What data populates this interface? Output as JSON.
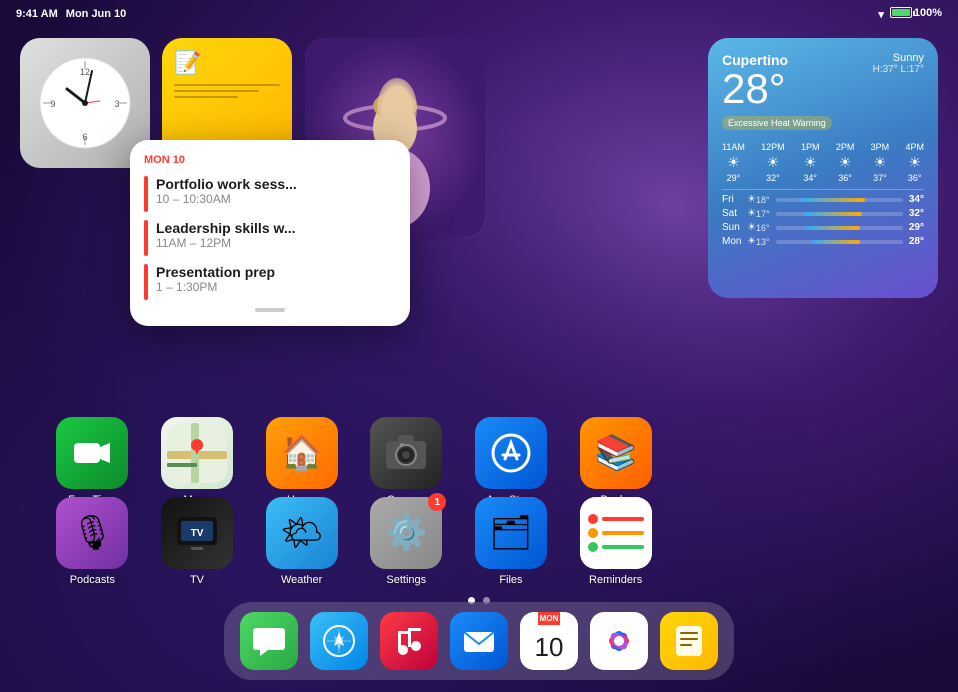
{
  "statusBar": {
    "time": "9:41 AM",
    "date": "Mon Jun 10",
    "wifi": "▼▲",
    "battery": "100%"
  },
  "weatherWidget": {
    "city": "Cupertino",
    "temperature": "28°",
    "condition": "Sunny",
    "high": "H:37°",
    "low": "L:17°",
    "warning": "Excessive Heat Warning",
    "hourly": [
      {
        "time": "11AM",
        "icon": "☀",
        "temp": "29°"
      },
      {
        "time": "12PM",
        "icon": "☀",
        "temp": "32°"
      },
      {
        "time": "1PM",
        "icon": "☀",
        "temp": "34°"
      },
      {
        "time": "2PM",
        "icon": "☀",
        "temp": "36°"
      },
      {
        "time": "3PM",
        "icon": "☀",
        "temp": "37°"
      },
      {
        "time": "4PM",
        "icon": "☀",
        "temp": "36°"
      }
    ],
    "daily": [
      {
        "day": "Fri",
        "icon": "☀",
        "low": "18°",
        "high": "34°",
        "barLeft": "20%",
        "barWidth": "50%"
      },
      {
        "day": "Sat",
        "icon": "☀",
        "low": "17°",
        "high": "32°",
        "barLeft": "22%",
        "barWidth": "48%"
      },
      {
        "day": "Sun",
        "icon": "☀",
        "low": "16°",
        "high": "29°",
        "barLeft": "24%",
        "barWidth": "45%"
      },
      {
        "day": "Mon",
        "icon": "☀",
        "low": "13°",
        "high": "28°",
        "barLeft": "28%",
        "barWidth": "40%"
      }
    ]
  },
  "calendarPopup": {
    "dayLabel": "MON",
    "dayNumber": "10",
    "events": [
      {
        "title": "Portfolio work sess...",
        "time": "10 – 10:30AM"
      },
      {
        "title": "Leadership skills w...",
        "time": "11AM – 12PM"
      },
      {
        "title": "Presentation prep",
        "time": "1 – 1:30PM"
      }
    ]
  },
  "appsRow1": [
    {
      "id": "facetime",
      "label": "FaceTime",
      "icon": "📹",
      "iconClass": "icon-facetime"
    },
    {
      "id": "maps",
      "label": "Maps",
      "icon": "🗺",
      "iconClass": "icon-maps"
    },
    {
      "id": "home",
      "label": "Home",
      "icon": "🏠",
      "iconClass": "icon-home"
    },
    {
      "id": "camera",
      "label": "Camera",
      "icon": "📷",
      "iconClass": "icon-camera"
    },
    {
      "id": "appstore",
      "label": "App Store",
      "icon": "Ⓐ",
      "iconClass": "icon-appstore"
    },
    {
      "id": "books",
      "label": "Books",
      "icon": "📚",
      "iconClass": "icon-books"
    }
  ],
  "appsRow2": [
    {
      "id": "podcasts",
      "label": "Podcasts",
      "icon": "🎙",
      "iconClass": "icon-podcasts"
    },
    {
      "id": "tv",
      "label": "TV",
      "icon": "📺",
      "iconClass": "icon-tv"
    },
    {
      "id": "weather",
      "label": "Weather",
      "icon": "🌤",
      "iconClass": "icon-weather"
    },
    {
      "id": "settings",
      "label": "Settings",
      "icon": "⚙️",
      "iconClass": "icon-settings",
      "badge": "1"
    },
    {
      "id": "files",
      "label": "Files",
      "icon": "🗂",
      "iconClass": "icon-files"
    },
    {
      "id": "reminders",
      "label": "Reminders",
      "icon": "📋",
      "iconClass": "icon-reminders"
    }
  ],
  "dock": {
    "items": [
      {
        "id": "messages",
        "iconClass": "icon-messages",
        "icon": "💬"
      },
      {
        "id": "safari",
        "iconClass": "icon-safari",
        "icon": "🧭"
      },
      {
        "id": "music",
        "iconClass": "icon-music",
        "icon": "🎵"
      },
      {
        "id": "mail",
        "iconClass": "icon-mail",
        "icon": "✉️"
      },
      {
        "id": "calendar",
        "iconClass": "icon-calendar-dock",
        "dayLabel": "MON",
        "day": "10"
      },
      {
        "id": "photos",
        "iconClass": "icon-photos",
        "icon": "🌸"
      },
      {
        "id": "notes",
        "iconClass": "icon-notes-dock",
        "icon": "📝"
      }
    ]
  }
}
